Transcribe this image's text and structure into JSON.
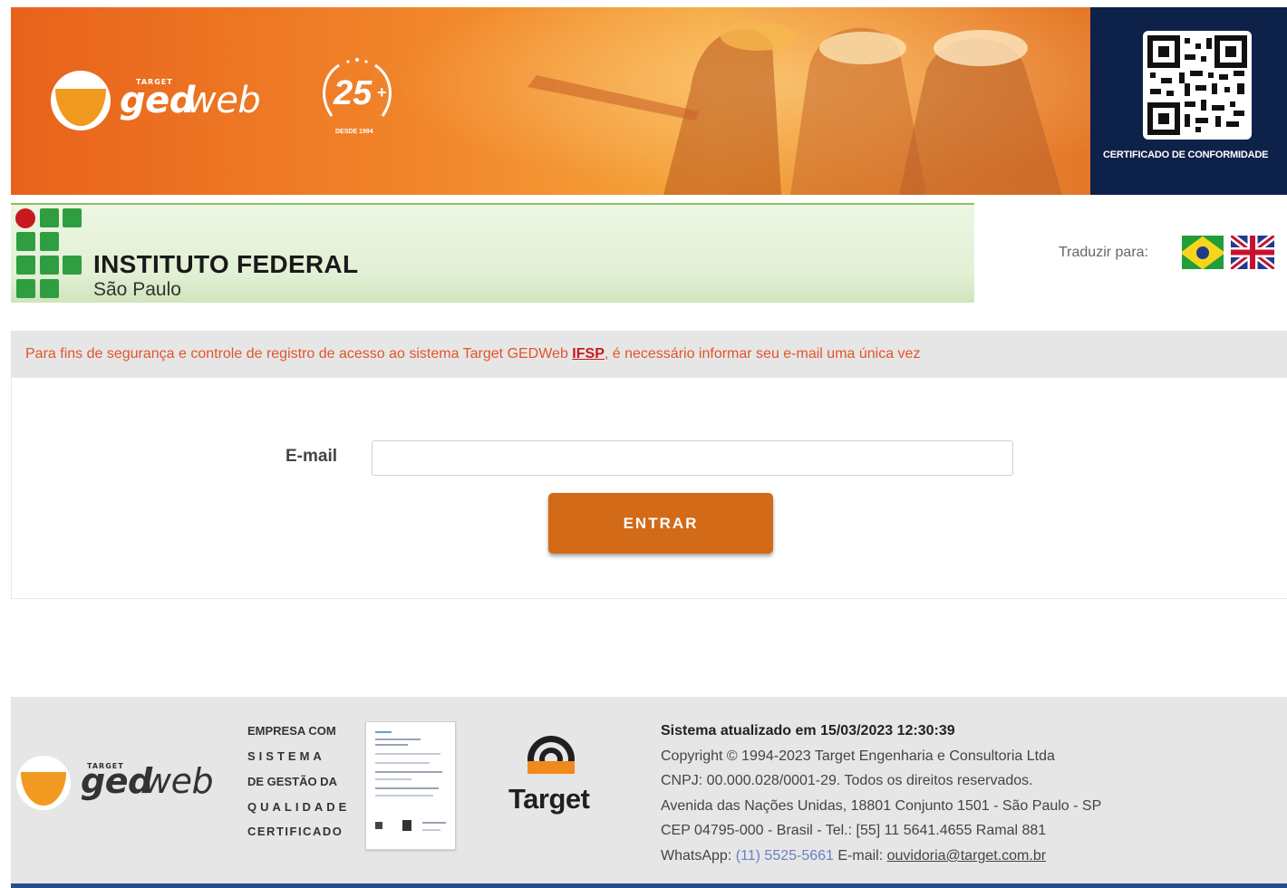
{
  "banner": {
    "brand_small": "TARGET",
    "brand_ged": "ged",
    "brand_web": "web",
    "anniversary_number": "25",
    "anniversary_plus": "+",
    "anniversary_since": "DESDE 1994",
    "qr_caption": "CERTIFICADO DE CONFORMIDADE"
  },
  "institution": {
    "title": "INSTITUTO FEDERAL",
    "subtitle": "São Paulo"
  },
  "translate": {
    "label": "Traduzir para:",
    "languages": [
      "pt-BR",
      "en"
    ]
  },
  "notice": {
    "text_before": "Para fins de segurança e controle de registro de acesso ao sistema Target GEDWeb ",
    "link": "IFSP",
    "text_after": ", é necessário informar seu e-mail uma única vez"
  },
  "login": {
    "email_label": "E-mail",
    "email_value": "",
    "submit_label": "ENTRAR"
  },
  "footer": {
    "brand_small": "TARGET",
    "brand_ged": "ged",
    "brand_web": "web",
    "cert_lines": [
      "EMPRESA COM",
      "SISTEMA",
      "DE GESTÃO DA",
      "QUALIDADE",
      "CERTIFICADO"
    ],
    "target_logo_text": "Target",
    "updated": "Sistema atualizado em 15/03/2023 12:30:39",
    "copyright": "Copyright © 1994-2023 Target Engenharia e Consultoria Ltda",
    "cnpj": "CNPJ: 00.000.028/0001-29. Todos os direitos reservados.",
    "address": "Avenida das Nações Unidas, 18801 Conjunto 1501 - São Paulo - SP",
    "cep": "CEP 04795-000 - Brasil - Tel.: [55] 11 5641.4655 Ramal 881",
    "whatsapp_label": "WhatsApp: ",
    "whatsapp_number": "(11) 5525-5661",
    "email_label": " E-mail: ",
    "email": "ouvidoria@target.com.br"
  },
  "colors": {
    "banner_orange": "#f2892c",
    "navy": "#0e2149",
    "if_green": "#2f9e41",
    "if_red": "#c8191e",
    "notice_text": "#e2552a",
    "button": "#d26a18"
  }
}
